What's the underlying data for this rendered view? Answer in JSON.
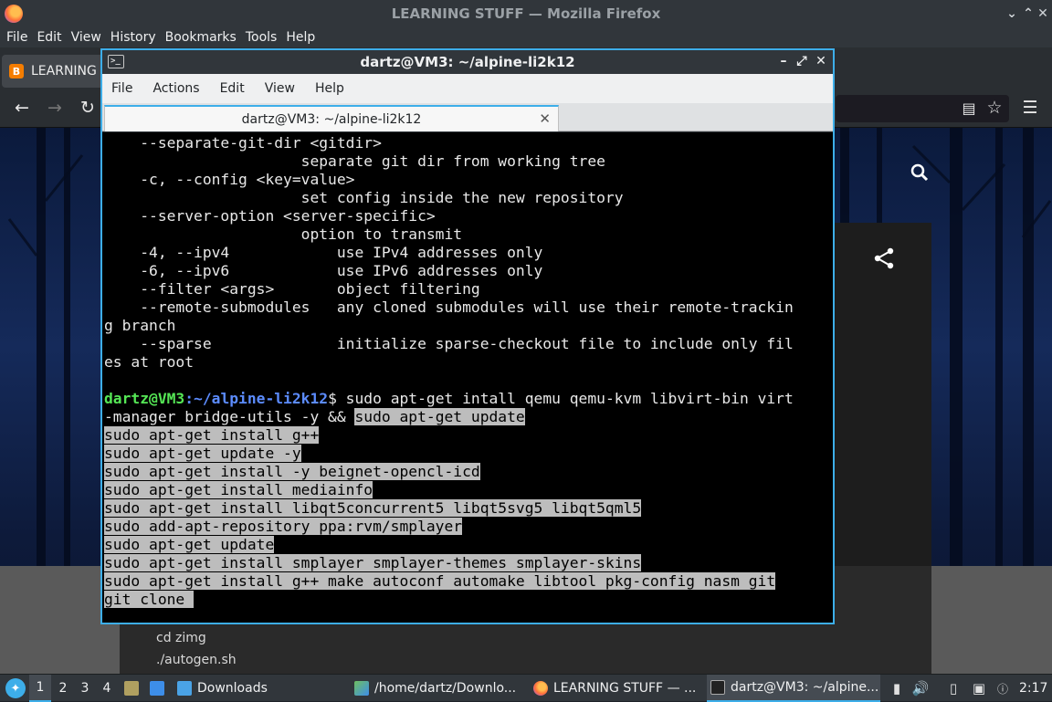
{
  "firefox": {
    "title": "LEARNING STUFF — Mozilla Firefox",
    "menu": [
      "File",
      "Edit",
      "View",
      "History",
      "Bookmarks",
      "Tools",
      "Help"
    ],
    "tab_label": "LEARNING S"
  },
  "terminal": {
    "title": "dartz@VM3: ~/alpine-li2k12",
    "menu": [
      "File",
      "Actions",
      "Edit",
      "View",
      "Help"
    ],
    "tab_label": "dartz@VM3: ~/alpine-li2k12",
    "lines": [
      "    --separate-git-dir <gitdir>",
      "                      separate git dir from working tree",
      "    -c, --config <key=value>",
      "                      set config inside the new repository",
      "    --server-option <server-specific>",
      "                      option to transmit",
      "    -4, --ipv4            use IPv4 addresses only",
      "    -6, --ipv6            use IPv6 addresses only",
      "    --filter <args>       object filtering",
      "    --remote-submodules   any cloned submodules will use their remote-trackin",
      "g branch",
      "    --sparse              initialize sparse-checkout file to include only fil",
      "es at root",
      ""
    ],
    "prompt_user": "dartz@VM3",
    "prompt_path": ":~/alpine-li2k12",
    "prompt_cmd": "$ sudo apt-get intall qemu qemu-kvm libvirt-bin virt",
    "cmd_cont": "-manager bridge-utils -y && ",
    "cmd_cont_hl": "sudo apt-get update",
    "hl_lines": [
      "sudo apt-get install g++",
      "sudo apt-get update -y",
      "sudo apt-get install -y beignet-opencl-icd",
      "sudo apt-get install mediainfo",
      "sudo apt-get install libqt5concurrent5 libqt5svg5 libqt5qml5",
      "sudo add-apt-repository ppa:rvm/smplayer",
      "sudo apt-get update",
      "sudo apt-get install smplayer smplayer-themes smplayer-skins",
      "sudo apt-get install g++ make autoconf automake libtool pkg-config nasm git",
      "git clone "
    ]
  },
  "page_content": {
    "lines": [
      "cd zimg",
      "./autogen.sh"
    ]
  },
  "taskbar": {
    "desktops": [
      "1",
      "2",
      "3",
      "4"
    ],
    "downloads": "Downloads",
    "task1": "/home/dartz/Downlo...",
    "task2": "LEARNING STUFF — ...",
    "task3": "dartz@VM3: ~/alpine...",
    "clock": "2:17"
  },
  "colors": {
    "accent": "#3daee9",
    "prompt_user": "#55e655",
    "prompt_path": "#5c8cff",
    "selection": "#bdbdbd"
  }
}
